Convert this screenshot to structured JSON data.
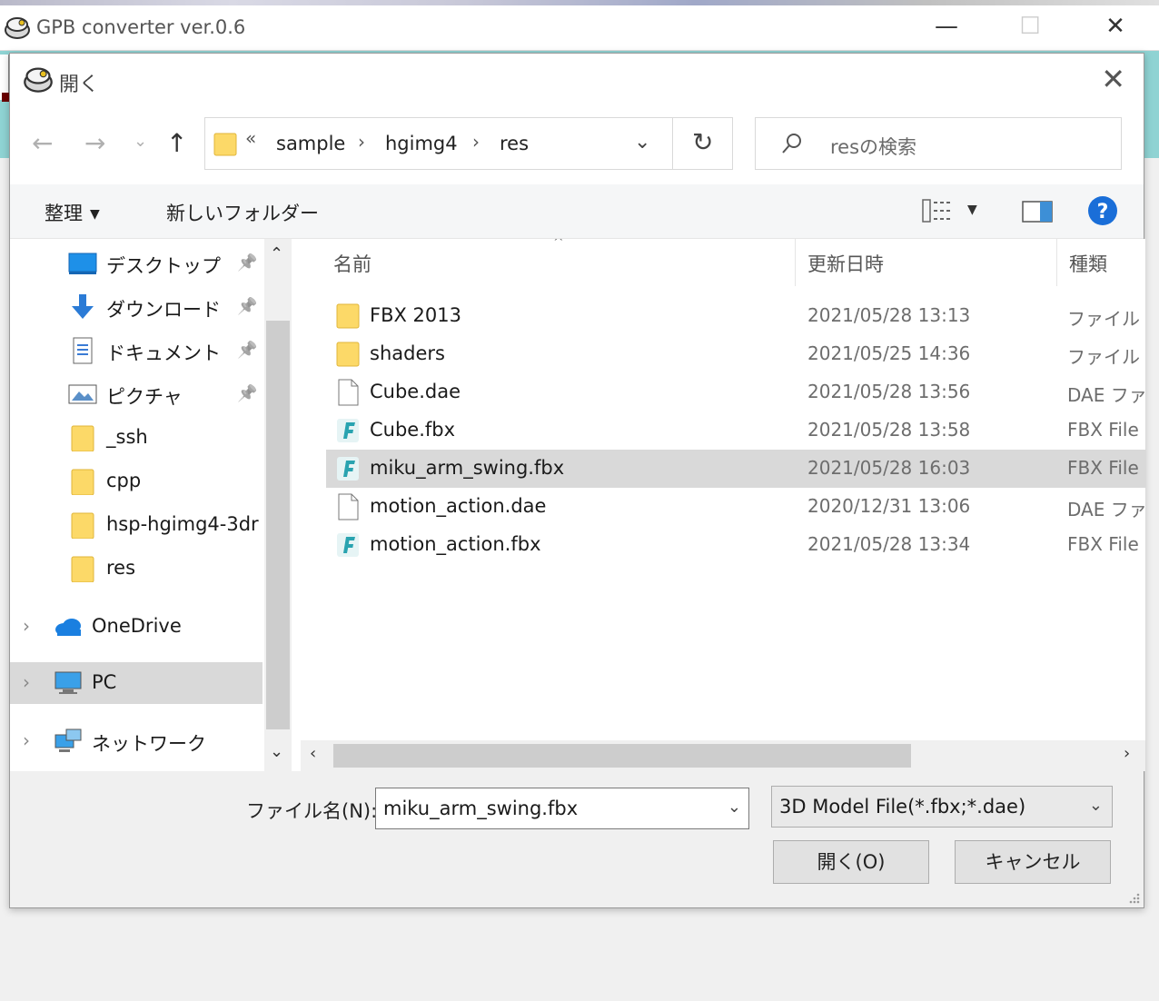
{
  "app": {
    "title": "GPB converter ver.0.6",
    "minimize": "—",
    "maximize": "☐",
    "close": "✕"
  },
  "dialog": {
    "title": "開く",
    "close": "✕",
    "nav": {
      "back": "←",
      "forward": "→",
      "recent": "⌄",
      "up": "↑"
    },
    "address": {
      "overflow": "«",
      "crumbs": [
        "sample",
        "hgimg4",
        "res"
      ],
      "sep": "›",
      "dropdown": "⌄",
      "refresh": "↻"
    },
    "search": {
      "placeholder": "resの検索"
    },
    "toolbar": {
      "organize": "整理",
      "caret": "▼",
      "new_folder": "新しいフォルダー",
      "view_caret": "▼",
      "help": "?"
    },
    "nav_pane": {
      "pin": "📌",
      "expander": "›",
      "items": [
        {
          "label": "デスクトップ",
          "icon": "desktop-icon",
          "pinned": true
        },
        {
          "label": "ダウンロード",
          "icon": "download-icon",
          "pinned": true
        },
        {
          "label": "ドキュメント",
          "icon": "document-icon",
          "pinned": true
        },
        {
          "label": "ピクチャ",
          "icon": "pictures-icon",
          "pinned": true
        },
        {
          "label": "_ssh",
          "icon": "folder-icon"
        },
        {
          "label": "cpp",
          "icon": "folder-icon"
        },
        {
          "label": "hsp-hgimg4-3dr",
          "icon": "folder-icon"
        },
        {
          "label": "res",
          "icon": "folder-icon"
        },
        {
          "label": "OneDrive",
          "icon": "cloud-icon"
        },
        {
          "label": "PC",
          "icon": "computer-icon",
          "selected": true
        },
        {
          "label": "ネットワーク",
          "icon": "network-icon"
        }
      ],
      "scroll_up": "⌃",
      "scroll_down": "⌄"
    },
    "file_list": {
      "columns": {
        "name": "名前",
        "modified": "更新日時",
        "type": "種類"
      },
      "sort_caret": "^",
      "rows": [
        {
          "name": "FBX 2013",
          "modified": "2021/05/28 13:13",
          "type": "ファイル フォルダー",
          "icon": "folder-icon"
        },
        {
          "name": "shaders",
          "modified": "2021/05/25 14:36",
          "type": "ファイル フォルダー",
          "icon": "folder-icon"
        },
        {
          "name": "Cube.dae",
          "modified": "2021/05/28 13:56",
          "type": "DAE ファイル",
          "icon": "file-icon"
        },
        {
          "name": "Cube.fbx",
          "modified": "2021/05/28 13:58",
          "type": "FBX File",
          "icon": "fbx-icon"
        },
        {
          "name": "miku_arm_swing.fbx",
          "modified": "2021/05/28 16:03",
          "type": "FBX File",
          "icon": "fbx-icon",
          "selected": true
        },
        {
          "name": "motion_action.dae",
          "modified": "2020/12/31 13:06",
          "type": "DAE ファイル",
          "icon": "file-icon"
        },
        {
          "name": "motion_action.fbx",
          "modified": "2021/05/28 13:34",
          "type": "FBX File",
          "icon": "fbx-icon"
        }
      ],
      "scroll_left": "‹",
      "scroll_right": "›"
    },
    "bottom": {
      "filename_label": "ファイル名(N):",
      "filename_value": "miku_arm_swing.fbx",
      "filename_dropdown": "⌄",
      "filetype_value": "3D Model File(*.fbx;*.dae)",
      "filetype_dropdown": "⌄",
      "open_label": "開く(O)",
      "cancel_label": "キャンセル"
    }
  }
}
